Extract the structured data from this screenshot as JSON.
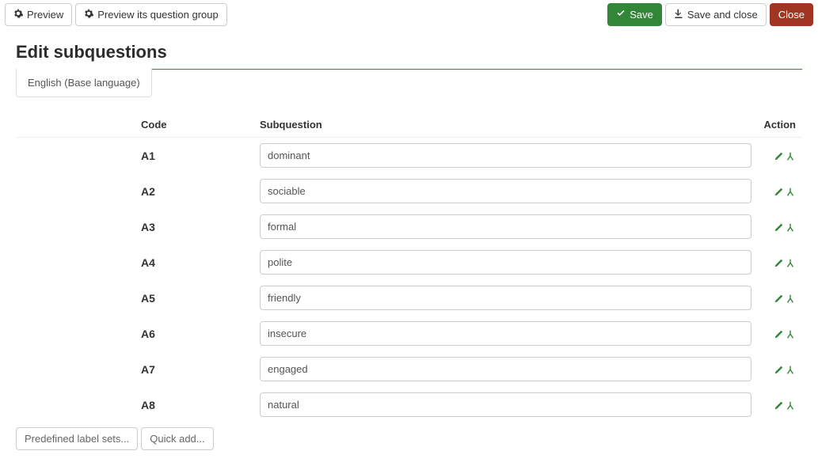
{
  "toolbar": {
    "preview": "Preview",
    "preview_group": "Preview its question group",
    "save": "Save",
    "save_close": "Save and close",
    "close": "Close"
  },
  "heading": "Edit subquestions",
  "tab_label": "English (Base language)",
  "headers": {
    "code": "Code",
    "subquestion": "Subquestion",
    "action": "Action"
  },
  "rows": [
    {
      "code": "A1",
      "text": "dominant"
    },
    {
      "code": "A2",
      "text": "sociable"
    },
    {
      "code": "A3",
      "text": "formal"
    },
    {
      "code": "A4",
      "text": "polite"
    },
    {
      "code": "A5",
      "text": "friendly"
    },
    {
      "code": "A6",
      "text": "insecure"
    },
    {
      "code": "A7",
      "text": "engaged"
    },
    {
      "code": "A8",
      "text": "natural"
    }
  ],
  "footer": {
    "predefined": "Predefined label sets...",
    "quick": "Quick add..."
  }
}
